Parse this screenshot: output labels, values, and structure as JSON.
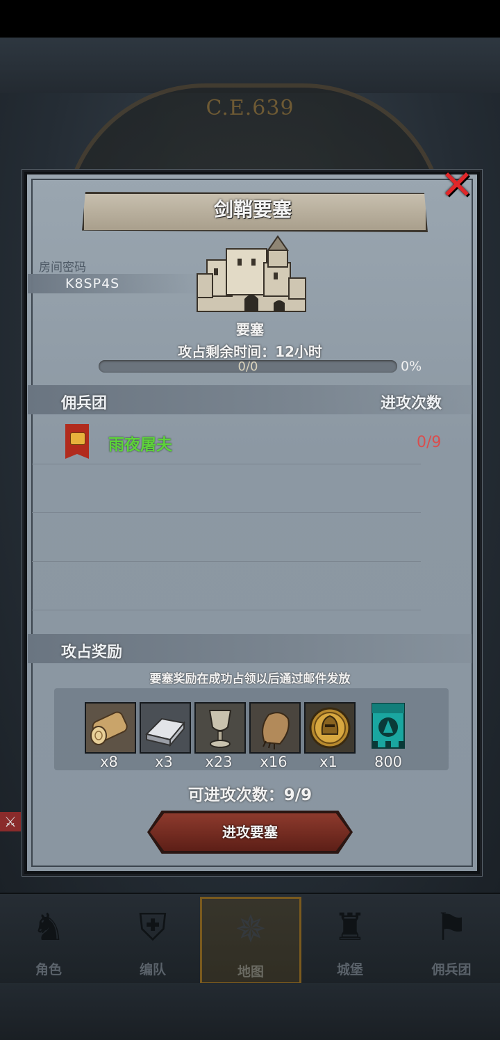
{
  "background": {
    "era_text": "C.E.639"
  },
  "dialog": {
    "title": "剑鞘要塞",
    "room_label": "房间密码",
    "room_code": "K8SP4S",
    "fort_type": "要塞",
    "time_remaining": "攻占剩余时间：12小时",
    "progress": {
      "text": "0/0",
      "percent_text": "0%",
      "fraction": 0
    },
    "mercenary_header": "佣兵团",
    "attack_count_header": "进攻次数",
    "mercenaries": [
      {
        "name": "雨夜屠夫",
        "attacks": "0/9"
      }
    ],
    "reward_header": "攻占奖励",
    "reward_note": "要塞奖励在成功占领以后通过邮件发放",
    "rewards": [
      {
        "icon": "wood-log-icon",
        "qty": "x8"
      },
      {
        "icon": "iron-ingot-icon",
        "qty": "x3"
      },
      {
        "icon": "goblet-icon",
        "qty": "x23"
      },
      {
        "icon": "fur-pelt-icon",
        "qty": "x16"
      },
      {
        "icon": "helmet-medal-icon",
        "qty": "x1"
      },
      {
        "icon": "guild-banner-icon",
        "qty": "800"
      }
    ],
    "attacks_left": "可进攻次数：9/9",
    "attack_button": "进攻要塞"
  },
  "nav": {
    "items": [
      {
        "label": "角色",
        "icon": "knight-icon"
      },
      {
        "label": "编队",
        "icon": "formation-icon"
      },
      {
        "label": "地图",
        "icon": "compass-icon",
        "active": true
      },
      {
        "label": "城堡",
        "icon": "castle-icon"
      },
      {
        "label": "佣兵团",
        "icon": "mercenary-icon"
      }
    ]
  },
  "colors": {
    "accent_red": "#e0272a",
    "mercenary_name": "#5ed23a",
    "attack_count": "#d94e4e",
    "button": "#8d3a2d"
  }
}
